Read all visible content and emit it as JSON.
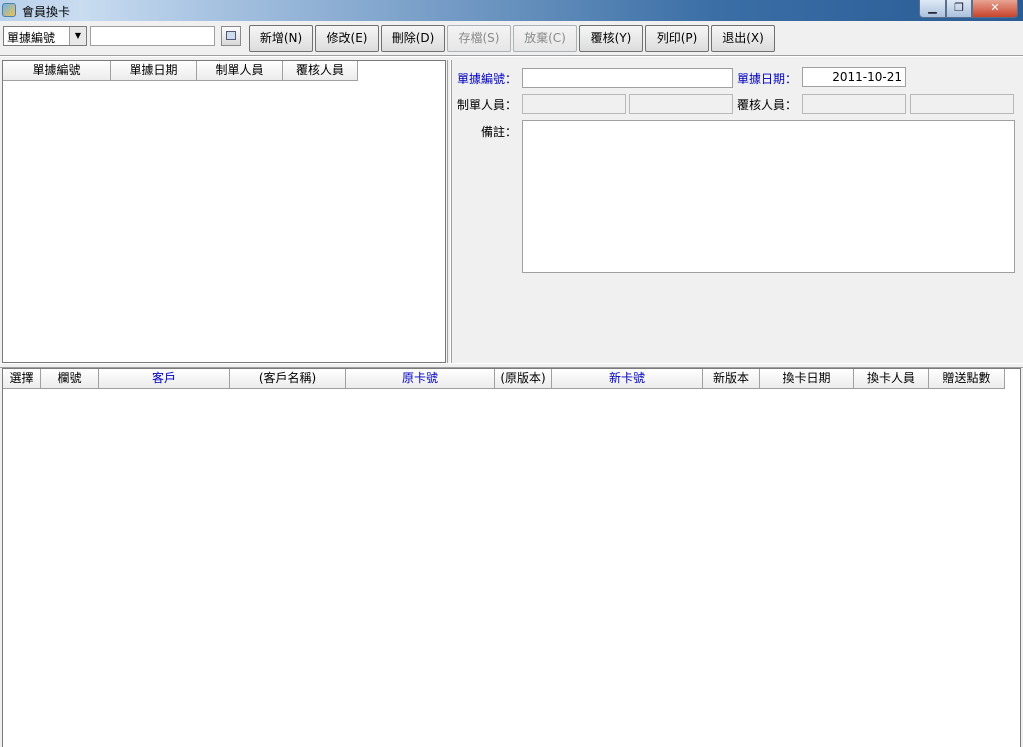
{
  "window": {
    "title": "會員換卡"
  },
  "toolbar": {
    "field_combo": "單據編號",
    "search_value": "",
    "buttons": {
      "add": "新增(N)",
      "edit": "修改(E)",
      "delete": "刪除(D)",
      "save": "存檔(S)",
      "discard": "放棄(C)",
      "review": "覆核(Y)",
      "print": "列印(P)",
      "exit": "退出(X)"
    }
  },
  "list": {
    "columns": [
      "單據編號",
      "單據日期",
      "制單人員",
      "覆核人員"
    ]
  },
  "form": {
    "doc_no_label": "單據編號：",
    "doc_no_value": "",
    "doc_date_label": "單據日期：",
    "doc_date_value": "2011-10-21",
    "creator_label": "制單人員：",
    "reviewer_label": "覆核人員：",
    "remark_label": "備註："
  },
  "detail": {
    "columns": [
      "選擇",
      "欄號",
      "客戶",
      "(客戶名稱)",
      "原卡號",
      "(原版本)",
      "新卡號",
      "新版本",
      "換卡日期",
      "換卡人員",
      "贈送點數"
    ]
  }
}
